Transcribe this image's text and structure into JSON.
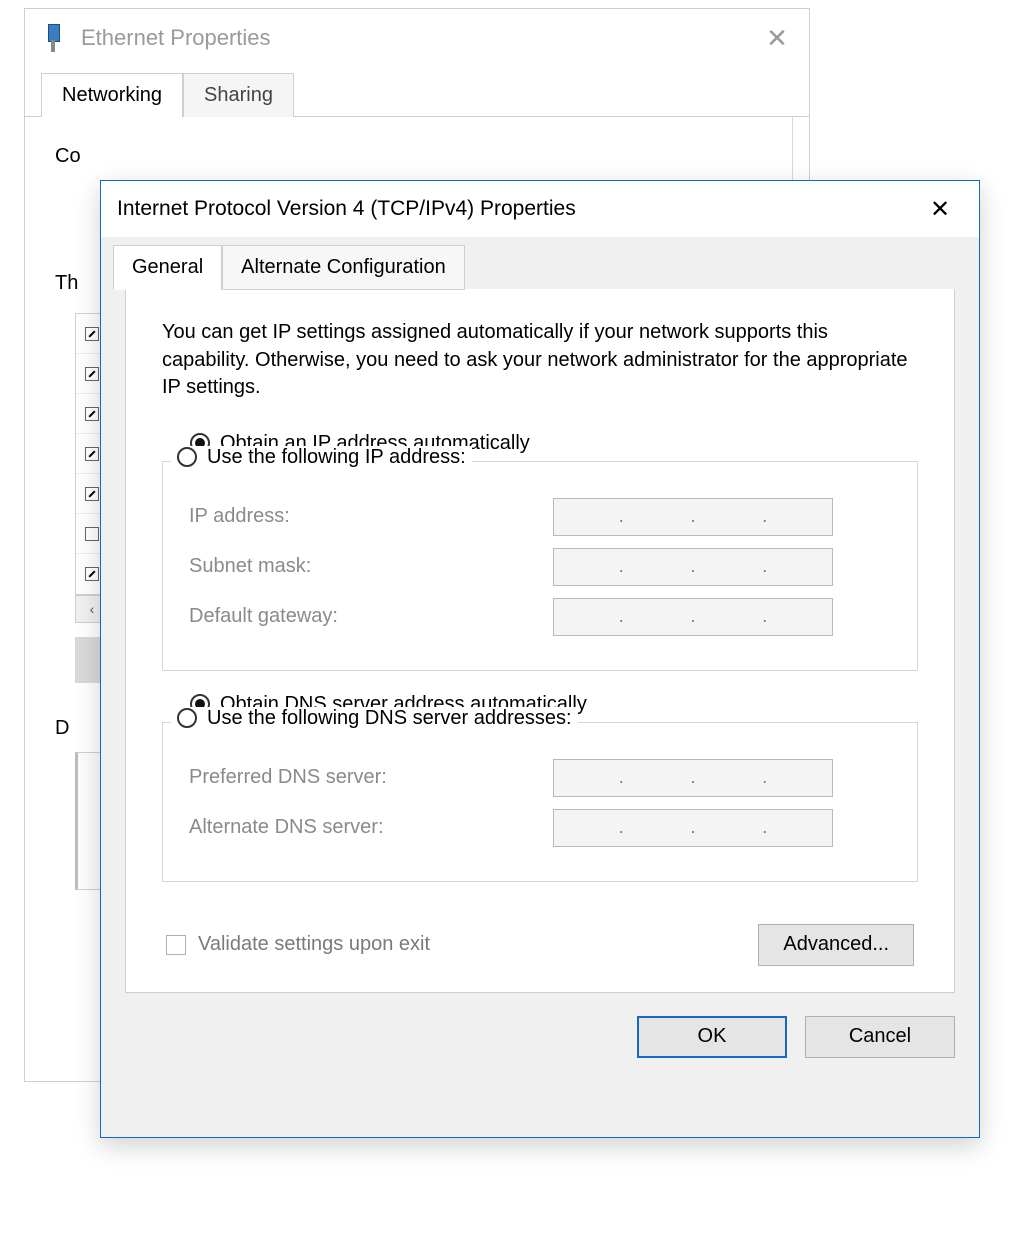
{
  "backWindow": {
    "title": "Ethernet Properties",
    "tabs": {
      "networking": "Networking",
      "sharing": "Sharing"
    },
    "fragments": {
      "co": "Co",
      "th": "Th",
      "d": "D",
      "arrow": "‹"
    }
  },
  "frontWindow": {
    "title": "Internet Protocol Version 4 (TCP/IPv4) Properties",
    "tabs": {
      "general": "General",
      "alternate": "Alternate Configuration"
    },
    "description": "You can get IP settings assigned automatically if your network supports this capability. Otherwise, you need to ask your network administrator for the appropriate IP settings.",
    "ip": {
      "autoLabel": "Obtain an IP address automatically",
      "manualLabel": "Use the following IP address:",
      "selected": "auto",
      "fields": {
        "ipAddress": {
          "label": "IP address:",
          "value": ""
        },
        "subnetMask": {
          "label": "Subnet mask:",
          "value": ""
        },
        "defaultGateway": {
          "label": "Default gateway:",
          "value": ""
        }
      }
    },
    "dns": {
      "autoLabel": "Obtain DNS server address automatically",
      "manualLabel": "Use the following DNS server addresses:",
      "selected": "auto",
      "fields": {
        "preferred": {
          "label": "Preferred DNS server:",
          "value": ""
        },
        "alternate": {
          "label": "Alternate DNS server:",
          "value": ""
        }
      }
    },
    "validateOnExit": {
      "label": "Validate settings upon exit",
      "checked": false
    },
    "buttons": {
      "advanced": "Advanced...",
      "ok": "OK",
      "cancel": "Cancel"
    }
  }
}
